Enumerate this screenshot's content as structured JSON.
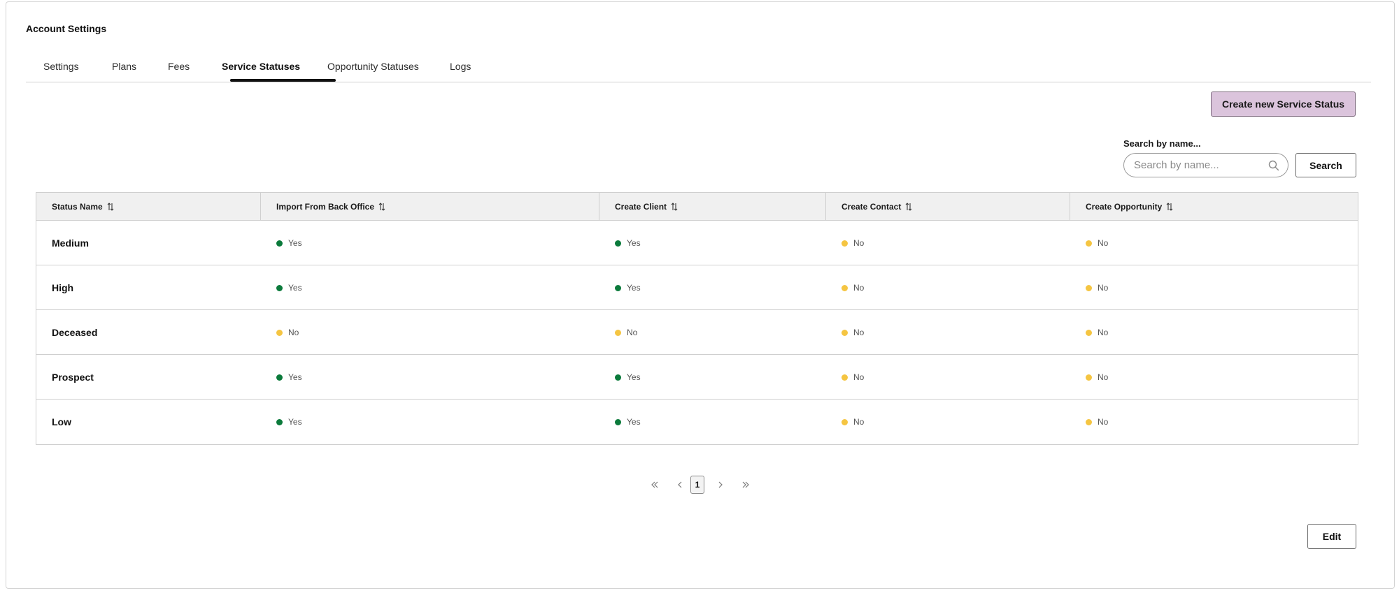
{
  "page": {
    "title": "Account Settings"
  },
  "tabs": [
    {
      "label": "Settings",
      "active": false
    },
    {
      "label": "Plans",
      "active": false
    },
    {
      "label": "Fees",
      "active": false
    },
    {
      "label": "Service Statuses",
      "active": true
    },
    {
      "label": "Opportunity Statuses",
      "active": false
    },
    {
      "label": "Logs",
      "active": false
    }
  ],
  "actions": {
    "create_label": "Create new Service Status",
    "edit_label": "Edit"
  },
  "search": {
    "label": "Search by name...",
    "placeholder": "Search by name...",
    "value": "",
    "button_label": "Search"
  },
  "colors": {
    "yes": "#0b7a3b",
    "no": "#f5c542",
    "create_button_bg": "#dbc4dc"
  },
  "table": {
    "columns": [
      "Status Name",
      "Import From Back Office",
      "Create Client",
      "Create Contact",
      "Create Opportunity"
    ],
    "rows": [
      {
        "name": "Medium",
        "import": "Yes",
        "client": "Yes",
        "contact": "No",
        "opportunity": "No"
      },
      {
        "name": "High",
        "import": "Yes",
        "client": "Yes",
        "contact": "No",
        "opportunity": "No"
      },
      {
        "name": "Deceased",
        "import": "No",
        "client": "No",
        "contact": "No",
        "opportunity": "No"
      },
      {
        "name": "Prospect",
        "import": "Yes",
        "client": "Yes",
        "contact": "No",
        "opportunity": "No"
      },
      {
        "name": "Low",
        "import": "Yes",
        "client": "Yes",
        "contact": "No",
        "opportunity": "No"
      }
    ]
  },
  "pagination": {
    "current_page": "1"
  }
}
